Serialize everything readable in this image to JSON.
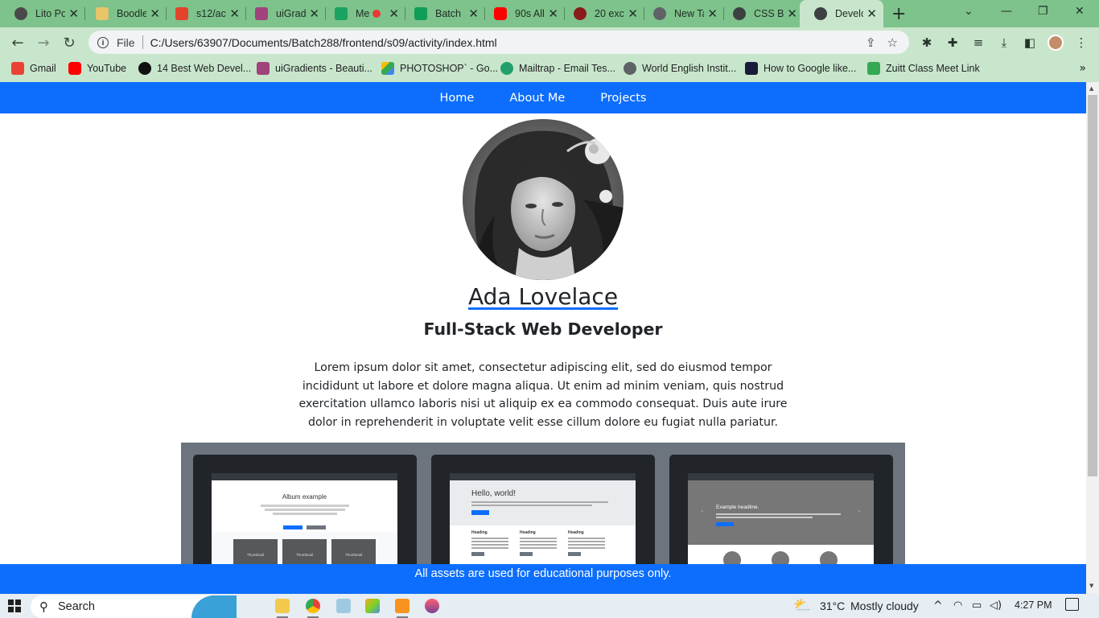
{
  "browser": {
    "tabs": [
      {
        "title": "Lito Po",
        "color": "#4a4a4a"
      },
      {
        "title": "Boodle",
        "color": "#e8c46a"
      },
      {
        "title": "s12/ac",
        "color": "#e2432a"
      },
      {
        "title": "uiGrad",
        "color": "#a0437c"
      },
      {
        "title": "Me",
        "color": "#1aa260"
      },
      {
        "title": "Batch",
        "color": "#0f9d58"
      },
      {
        "title": "90s All",
        "color": "#ff0000"
      },
      {
        "title": "20 exc",
        "color": "#8a1b1b"
      },
      {
        "title": "New Ta",
        "color": "#5f6368"
      },
      {
        "title": "CSS Bo",
        "color": "#3c4043"
      },
      {
        "title": "Develo",
        "color": "#3c4043"
      }
    ],
    "new_tab_label": "+",
    "address": {
      "scheme_label": "File",
      "url": "C:/Users/63907/Documents/Batch288/frontend/s09/activity/index.html"
    },
    "bookmarks": [
      {
        "label": "Gmail",
        "color": "#ea4335"
      },
      {
        "label": "YouTube",
        "color": "#ff0000"
      },
      {
        "label": "14 Best Web Devel...",
        "color": "#111111"
      },
      {
        "label": "uiGradients - Beauti...",
        "color": "#a0437c"
      },
      {
        "label": "PHOTOSHOP` - Go...",
        "color": "#fbbc04"
      },
      {
        "label": "Mailtrap - Email Tes...",
        "color": "#22a06b"
      },
      {
        "label": "World English Instit...",
        "color": "#5f6368"
      },
      {
        "label": "How to Google like...",
        "color": "#1a1a3a"
      },
      {
        "label": "Zuitt Class Meet Link",
        "color": "#34a853"
      }
    ]
  },
  "site": {
    "nav": [
      "Home",
      "About Me",
      "Projects"
    ],
    "name": "Ada Lovelace",
    "role": "Full-Stack Web Developer",
    "bio": "Lorem ipsum dolor sit amet, consectetur adipiscing elit, sed do eiusmod tempor incididunt ut labore et dolore magna aliqua. Ut enim ad minim veniam, quis nostrud exercitation ullamco laboris nisi ut aliquip ex ea commodo consequat. Duis aute irure dolor in reprehenderit in voluptate velit esse cillum dolore eu fugiat nulla pariatur.",
    "projects": [
      {
        "heading": "Album example",
        "thumb_label": "Thumbnail"
      },
      {
        "heading": "Hello, world!",
        "column_label": "Heading"
      },
      {
        "heading": "Example headline."
      }
    ],
    "footer": "All assets are used for educational purposes only."
  },
  "taskbar": {
    "search_label": "Search",
    "weather": {
      "temp": "31°C",
      "condition": "Mostly cloudy"
    },
    "clock": "4:27 PM"
  },
  "colors": {
    "primary": "#0d6efd",
    "tab_strip": "#7ec28c",
    "toolbar": "#c8e6cb",
    "projects_bg": "#6c757d",
    "card_bg": "#212529"
  }
}
